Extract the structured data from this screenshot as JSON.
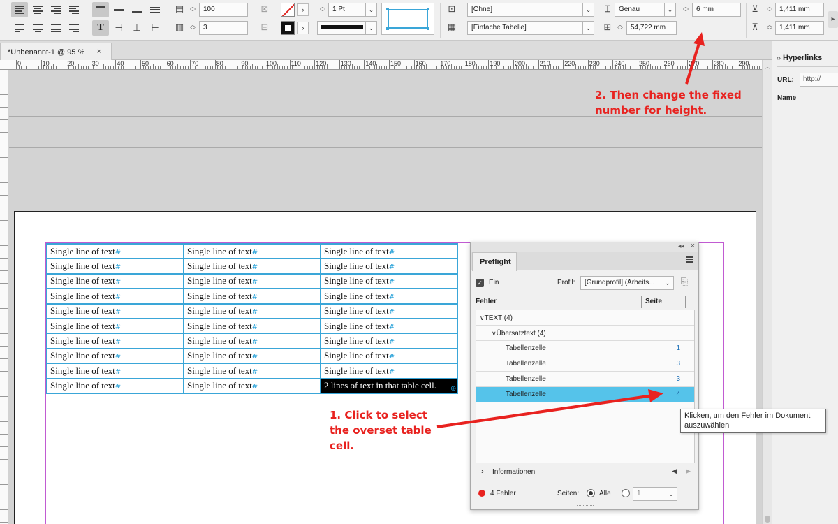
{
  "control_bar": {
    "stroke_weight": "1 Pt",
    "scale_value": "100",
    "columns_value": "3",
    "cell_style": "[Ohne]",
    "table_style": "[Einfache Tabelle]",
    "row_height_mode": "Genau",
    "row_height_value": "6 mm",
    "column_width_value": "54,722 mm",
    "inset_top": "1,411 mm",
    "inset_bottom": "1,411 mm"
  },
  "document": {
    "tab_title": "*Unbenannt-1 @ 95 %",
    "close_glyph": "×"
  },
  "ruler": {
    "h_labels": [
      "0",
      "10",
      "20",
      "30",
      "40",
      "50",
      "60",
      "70",
      "80",
      "90",
      "100",
      "110",
      "120",
      "130",
      "140",
      "150",
      "160",
      "170",
      "180",
      "190",
      "200",
      "210",
      "220",
      "230",
      "240",
      "250",
      "260",
      "270",
      "280",
      "290"
    ]
  },
  "table": {
    "rows": [
      [
        "Single line of text",
        "Single line of text",
        "Single line of text"
      ],
      [
        "Single line of text",
        "Single line of text",
        "Single line of text"
      ],
      [
        "Single line of text",
        "Single line of text",
        "Single line of text"
      ],
      [
        "Single line of text",
        "Single line of text",
        "Single line of text"
      ],
      [
        "Single line of text",
        "Single line of text",
        "Single line of text"
      ],
      [
        "Single line of text",
        "Single line of text",
        "Single line of text"
      ],
      [
        "Single line of text",
        "Single line of text",
        "Single line of text"
      ],
      [
        "Single line of text",
        "Single line of text",
        "Single line of text"
      ],
      [
        "Single line of text",
        "Single line of text",
        "Single line of text"
      ],
      [
        "Single line of text",
        "Single line of text",
        "2 lines of text in that table cell."
      ]
    ],
    "pilcrow": "#"
  },
  "preflight": {
    "tab": "Preflight",
    "on_label": "Ein",
    "profile_label": "Profil:",
    "profile_value": "[Grundprofil] (Arbeits...",
    "col_errors": "Fehler",
    "col_page": "Seite",
    "group": "TEXT (4)",
    "subgroup": "Übersatztext (4)",
    "items": [
      {
        "label": "Tabellenzelle",
        "page": "1"
      },
      {
        "label": "Tabellenzelle",
        "page": "3"
      },
      {
        "label": "Tabellenzelle",
        "page": "3"
      },
      {
        "label": "Tabellenzelle",
        "page": "4"
      }
    ],
    "info_label": "Informationen",
    "error_count": "4 Fehler",
    "pages_label": "Seiten:",
    "all_label": "Alle",
    "page_field": "1",
    "status_color": "#e8221f",
    "highlight_color": "#55c3ea"
  },
  "tooltip": {
    "text": "Klicken, um den Fehler im Dokument auszuwählen"
  },
  "hyperlinks_panel": {
    "title": "Hyperlinks",
    "url_label": "URL:",
    "url_value": "http://",
    "name_label": "Name"
  },
  "annotations": {
    "step1": [
      "1. Click to select",
      "the overset table",
      "cell."
    ],
    "step2": [
      "2. Then change the fixed",
      "number for height."
    ],
    "color": "#e8221f"
  }
}
